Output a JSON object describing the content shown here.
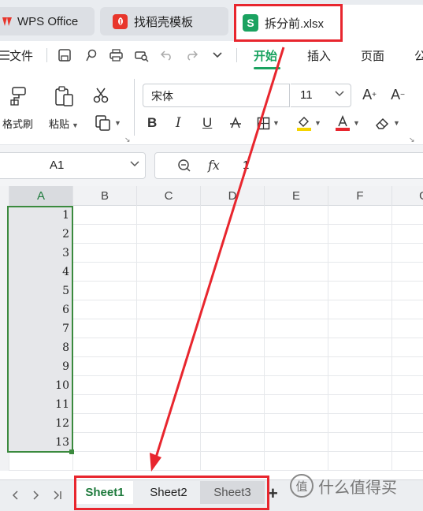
{
  "title_tabs": [
    {
      "label": "WPS Office",
      "icon": "wps-logo-icon"
    },
    {
      "label": "找稻壳模板",
      "icon": "docer-logo-icon"
    },
    {
      "label": "拆分前.xlsx",
      "icon": "spreadsheet-s-icon",
      "icon_text": "S"
    }
  ],
  "menu": {
    "file_label": "文件",
    "tabs": [
      "开始",
      "插入",
      "页面",
      "公"
    ],
    "active_tab": "开始"
  },
  "ribbon": {
    "format_painter_label": "格式刷",
    "paste_label": "粘贴",
    "font_name": "宋体",
    "font_size": "11"
  },
  "formula_bar": {
    "name_box_value": "A1",
    "fx_label": "fx",
    "content": "1"
  },
  "grid": {
    "columns": [
      "A",
      "B",
      "C",
      "D",
      "E",
      "F",
      "G"
    ],
    "selected_column": "A",
    "values_col_a": [
      "1",
      "2",
      "3",
      "4",
      "5",
      "6",
      "7",
      "8",
      "9",
      "10",
      "11",
      "12",
      "13"
    ]
  },
  "sheets": {
    "tabs": [
      "Sheet1",
      "Sheet2",
      "Sheet3"
    ],
    "active": "Sheet1",
    "add_label": "+"
  },
  "watermark": {
    "badge": "值",
    "text": "什么值得买"
  },
  "colors": {
    "accent_green": "#1aa260",
    "annotation_red": "#e8262e",
    "font_color_underline": "#e8262e",
    "fill_color_underline": "#f5d400"
  }
}
